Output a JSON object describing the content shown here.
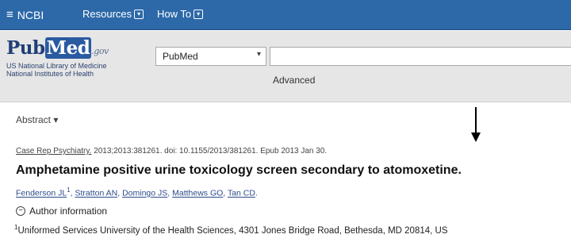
{
  "topbar": {
    "brand": "NCBI",
    "menus": [
      "Resources",
      "How To"
    ]
  },
  "banner": {
    "logo_pub": "Pub",
    "logo_med": "Med",
    "logo_gov": ".gov",
    "logo_sub_line1": "US National Library of Medicine",
    "logo_sub_line2": "National Institutes of Health",
    "database_selected": "PubMed",
    "search_value": "",
    "advanced_label": "Advanced"
  },
  "content": {
    "format_label": "Abstract",
    "citation_journal": "Case Rep Psychiatry.",
    "citation_rest": " 2013;2013:381261. doi: 10.1155/2013/381261. Epub 2013 Jan 30.",
    "title": "Amphetamine positive urine toxicology screen secondary to atomoxetine.",
    "authors": [
      "Fenderson JL",
      "Stratton AN",
      "Domingo JS",
      "Matthews GO",
      "Tan CD"
    ],
    "first_author_sup": "1",
    "author_info_label": "Author information",
    "affiliation_sup": "1",
    "affiliation_text": "Uniformed Services University of the Health Sciences, 4301 Jones Bridge Road, Bethesda, MD 20814, US"
  },
  "colors": {
    "topbar": "#2d69a8",
    "banner": "#e6e6e6",
    "brand_blue": "#203f78"
  }
}
